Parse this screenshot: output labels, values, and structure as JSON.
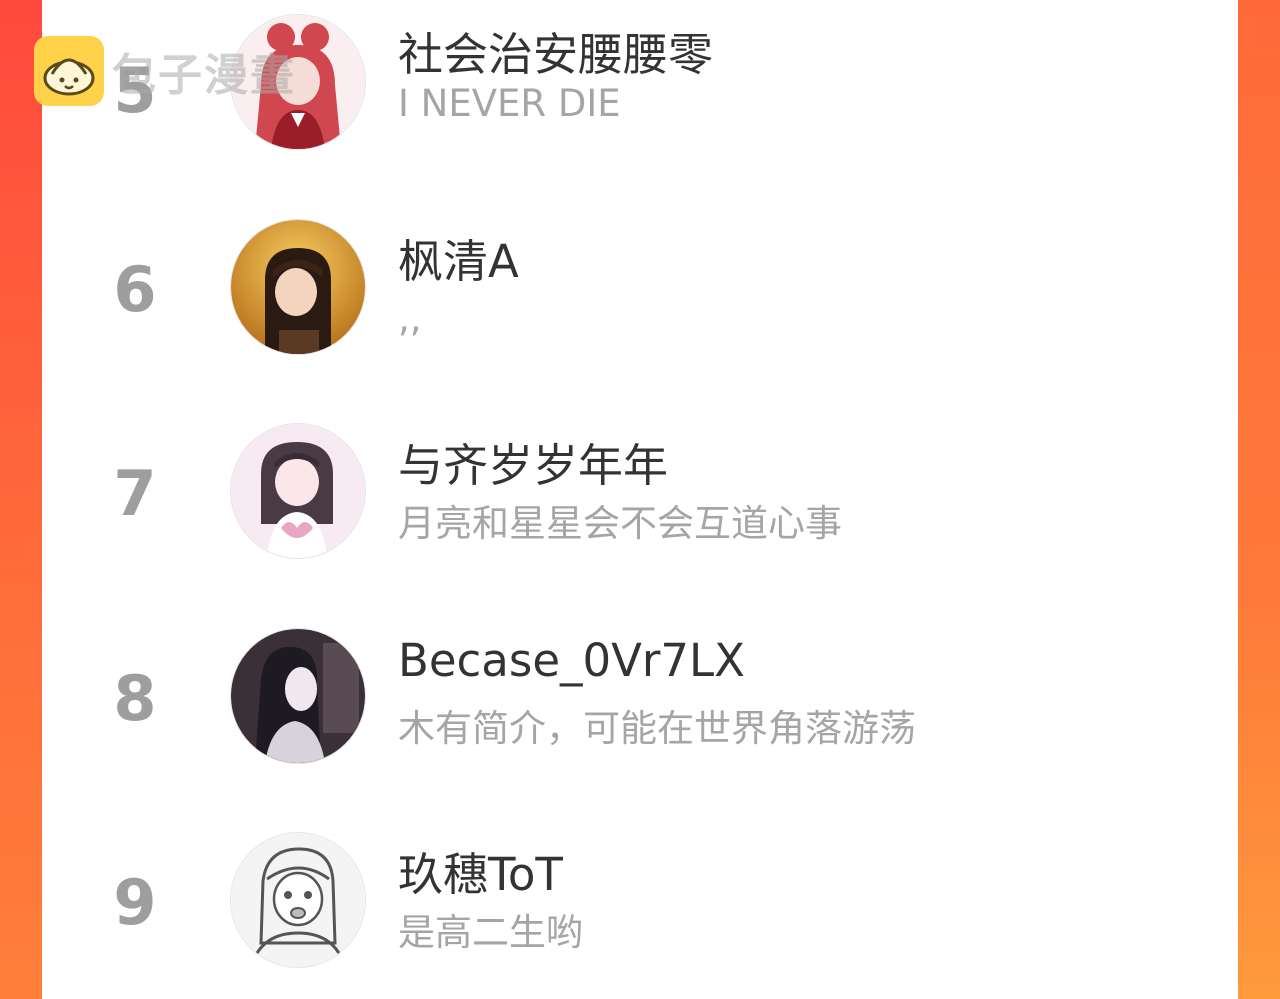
{
  "watermark": {
    "text": "包子漫畫",
    "icon": "bun-icon"
  },
  "users": [
    {
      "rank": "5",
      "name": "社会治安腰腰零",
      "bio": "I NEVER DIE",
      "avatar_colors": [
        "#f3d7d9",
        "#d0474f",
        "#9b1d2a"
      ]
    },
    {
      "rank": "6",
      "name": "枫清A",
      "bio": ",,",
      "avatar_colors": [
        "#f0b03a",
        "#5a3a22",
        "#2a1a12"
      ]
    },
    {
      "rank": "7",
      "name": "与齐岁岁年年",
      "bio": "月亮和星星会不会互道心事",
      "avatar_colors": [
        "#f7eaf2",
        "#e7b7cc",
        "#4a3a44"
      ]
    },
    {
      "rank": "8",
      "name": "Becase_0Vr7LX",
      "bio": "木有简介，可能在世界角落游荡",
      "avatar_colors": [
        "#3a3038",
        "#d8d2da",
        "#1e1a22"
      ]
    },
    {
      "rank": "9",
      "name": "玖穗ToT",
      "bio": "是高二生哟",
      "avatar_colors": [
        "#f4f4f4",
        "#bdbdbd",
        "#555555"
      ]
    }
  ]
}
